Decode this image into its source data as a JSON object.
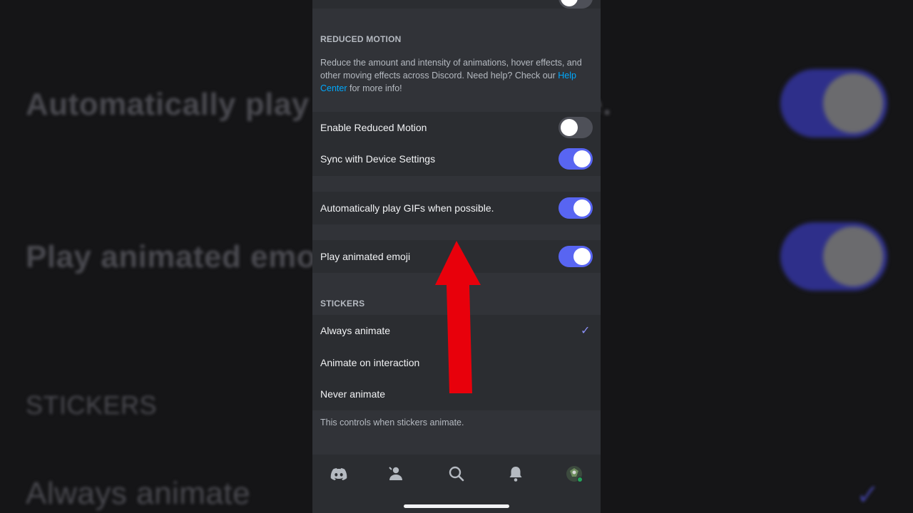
{
  "background": {
    "text_1": "Automatically play",
    "text_1_tail": "e.",
    "text_2": "Play animated emo",
    "text_3": "STICKERS",
    "text_4": "Always animate"
  },
  "reduced_motion": {
    "header": "REDUCED MOTION",
    "desc_part1": "Reduce the amount and intensity of animations, hover effects, and other moving effects across Discord. Need help? Check our ",
    "desc_link": "Help Center",
    "desc_part2": " for more info!",
    "enable_label": "Enable Reduced Motion",
    "enable_on": false,
    "sync_label": "Sync with Device Settings",
    "sync_on": true
  },
  "gifs": {
    "label": "Automatically play GIFs when possible.",
    "on": true
  },
  "emoji": {
    "label": "Play animated emoji",
    "on": true
  },
  "stickers": {
    "header": "STICKERS",
    "options": [
      "Always animate",
      "Animate on interaction",
      "Never animate"
    ],
    "selected": "Always animate",
    "footer": "This controls when stickers animate."
  },
  "nav": {
    "icons": [
      "discord-home-icon",
      "friends-icon",
      "search-icon",
      "bell-icon",
      "avatar-icon"
    ]
  },
  "colors": {
    "accent": "#5865f2",
    "link": "#00a8fc",
    "arrow": "#e8000b"
  }
}
